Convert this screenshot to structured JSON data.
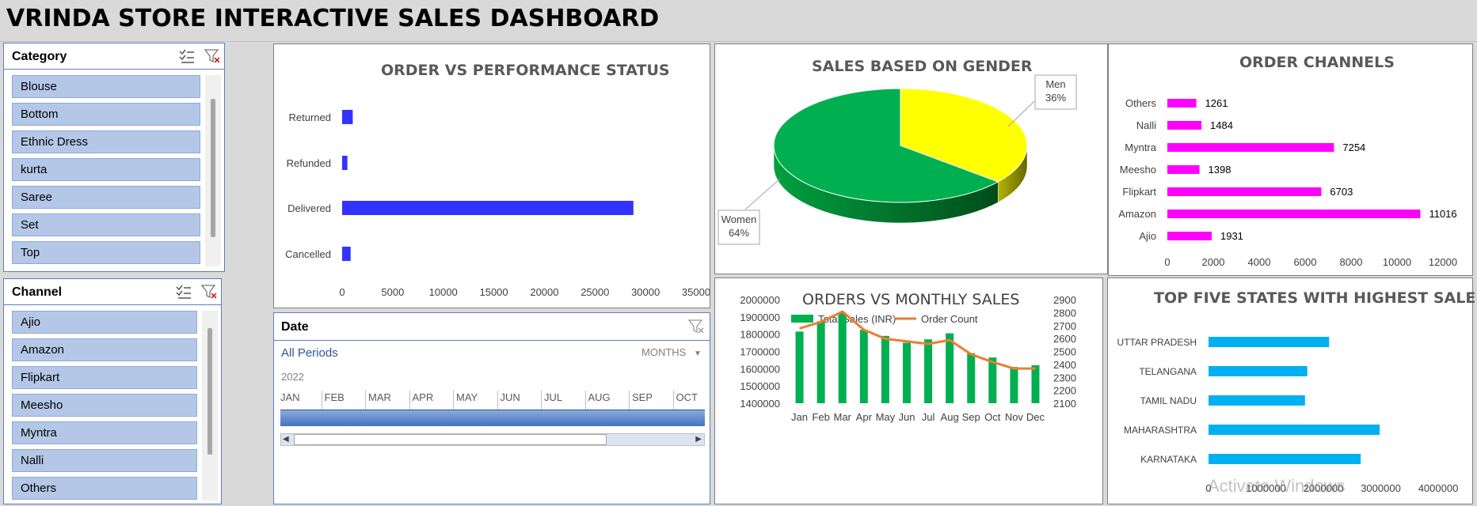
{
  "header": {
    "title": "VRINDA STORE INTERACTIVE SALES DASHBOARD"
  },
  "category_slicer": {
    "title": "Category",
    "items": [
      "Blouse",
      "Bottom",
      "Ethnic Dress",
      "kurta",
      "Saree",
      "Set",
      "Top"
    ]
  },
  "channel_slicer": {
    "title": "Channel",
    "items": [
      "Ajio",
      "Amazon",
      "Flipkart",
      "Meesho",
      "Myntra",
      "Nalli",
      "Others"
    ]
  },
  "date_slicer": {
    "title": "Date",
    "period_label": "All Periods",
    "level_label": "MONTHS",
    "year": "2022",
    "months": [
      "JAN",
      "FEB",
      "MAR",
      "APR",
      "MAY",
      "JUN",
      "JUL",
      "AUG",
      "SEP",
      "OCT"
    ]
  },
  "watermark": "Activate Windows",
  "colors": {
    "order_status_bar": "#3333ff",
    "gender_men": "#ffff00",
    "gender_women": "#00b050",
    "channels_bar": "#ff00ff",
    "monthly_sales_bar": "#00b050",
    "order_count_line": "#ed7d31",
    "states_bar": "#00b0f0",
    "slicer_item": "#b4c7e7"
  },
  "chart_data": [
    {
      "id": "order_status",
      "type": "bar",
      "orientation": "horizontal",
      "title": "ORDER VS PERFORMANCE STATUS",
      "categories": [
        "Returned",
        "Refunded",
        "Delivered",
        "Cancelled"
      ],
      "values": [
        1050,
        520,
        28800,
        840
      ],
      "xlim": [
        0,
        35000
      ],
      "ticks": [
        "0",
        "5000",
        "10000",
        "15000",
        "20000",
        "25000",
        "30000",
        "35000"
      ]
    },
    {
      "id": "gender",
      "type": "pie",
      "title": "SALES BASED ON GENDER",
      "labels": [
        "Men",
        "Women"
      ],
      "values": [
        36,
        64
      ],
      "value_labels": [
        "36%",
        "64%"
      ]
    },
    {
      "id": "channels",
      "type": "bar",
      "orientation": "horizontal",
      "title": "ORDER CHANNELS",
      "categories": [
        "Others",
        "Nalli",
        "Myntra",
        "Meesho",
        "Flipkart",
        "Amazon",
        "Ajio"
      ],
      "values": [
        1261,
        1484,
        7254,
        1398,
        6703,
        11016,
        1931
      ],
      "value_labels": [
        "1261",
        "1484",
        "7254",
        "1398",
        "6703",
        "11016",
        "1931"
      ],
      "xlim": [
        0,
        12000
      ],
      "ticks": [
        "0",
        "2000",
        "4000",
        "6000",
        "8000",
        "10000",
        "12000"
      ]
    },
    {
      "id": "monthly",
      "type": "bar",
      "title": "ORDERS VS MONTHLY SALES",
      "categories": [
        "Jan",
        "Feb",
        "Mar",
        "Apr",
        "May",
        "Jun",
        "Jul",
        "Aug",
        "Sep",
        "Oct",
        "Nov",
        "Dec"
      ],
      "series": [
        {
          "name": "Total Sales (INR)",
          "type": "bar",
          "values": [
            1815000,
            1875000,
            1925000,
            1825000,
            1790000,
            1750000,
            1770000,
            1805000,
            1690000,
            1665000,
            1610000,
            1620000
          ]
        },
        {
          "name": "Order Count",
          "type": "line",
          "values": [
            2690,
            2740,
            2820,
            2680,
            2610,
            2590,
            2570,
            2600,
            2490,
            2430,
            2380,
            2380
          ]
        }
      ],
      "ylim": [
        1400000,
        2000000
      ],
      "ylim_secondary": [
        2100,
        2900
      ],
      "yticks": [
        "2000000",
        "1900000",
        "1800000",
        "1700000",
        "1600000",
        "1500000",
        "1400000"
      ],
      "yticks_secondary": [
        "2900",
        "2800",
        "2700",
        "2600",
        "2500",
        "2400",
        "2300",
        "2200",
        "2100"
      ],
      "legend": "top"
    },
    {
      "id": "states",
      "type": "bar",
      "orientation": "horizontal",
      "title": "TOP FIVE STATES WITH HIGHEST SALE",
      "categories": [
        "UTTAR PRADESH",
        "TELANGANA",
        "TAMIL NADU",
        "MAHARASHTRA",
        "KARNATAKA"
      ],
      "values": [
        2100000,
        1720000,
        1680000,
        2980000,
        2650000
      ],
      "xlim": [
        0,
        4000000
      ],
      "ticks": [
        "0",
        "1000000",
        "2000000",
        "3000000",
        "4000000"
      ]
    }
  ]
}
